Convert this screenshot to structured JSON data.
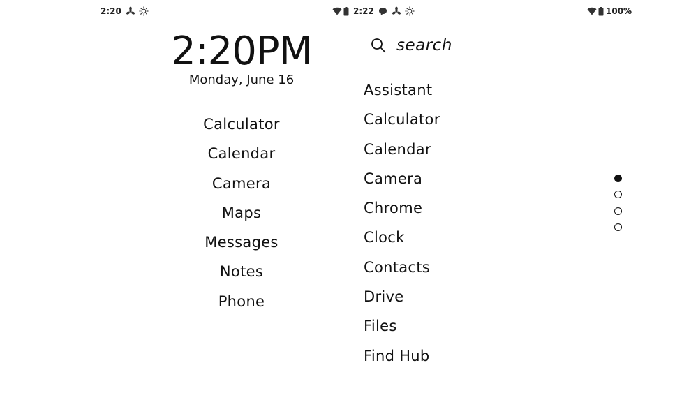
{
  "status_left": {
    "time": "2:20",
    "icons": [
      "fan-icon",
      "brightness-icon"
    ]
  },
  "status_middle": {
    "time": "2:22",
    "icons": [
      "wifi-icon",
      "battery-icon",
      "message-icon",
      "fan-icon",
      "brightness-icon"
    ]
  },
  "status_right": {
    "battery_percent": "100%",
    "icons": [
      "wifi-icon",
      "battery-icon"
    ]
  },
  "home": {
    "time": "2:20PM",
    "date": "Monday, June 16",
    "apps": [
      "Calculator",
      "Calendar",
      "Camera",
      "Maps",
      "Messages",
      "Notes",
      "Phone"
    ]
  },
  "drawer": {
    "search_label": "search",
    "apps": [
      "Assistant",
      "Calculator",
      "Calendar",
      "Camera",
      "Chrome",
      "Clock",
      "Contacts",
      "Drive",
      "Files",
      "Find Hub"
    ]
  },
  "page_indicator": {
    "total": 4,
    "active_index": 0
  },
  "colors": {
    "background": "#ffffff",
    "foreground": "#111111"
  }
}
